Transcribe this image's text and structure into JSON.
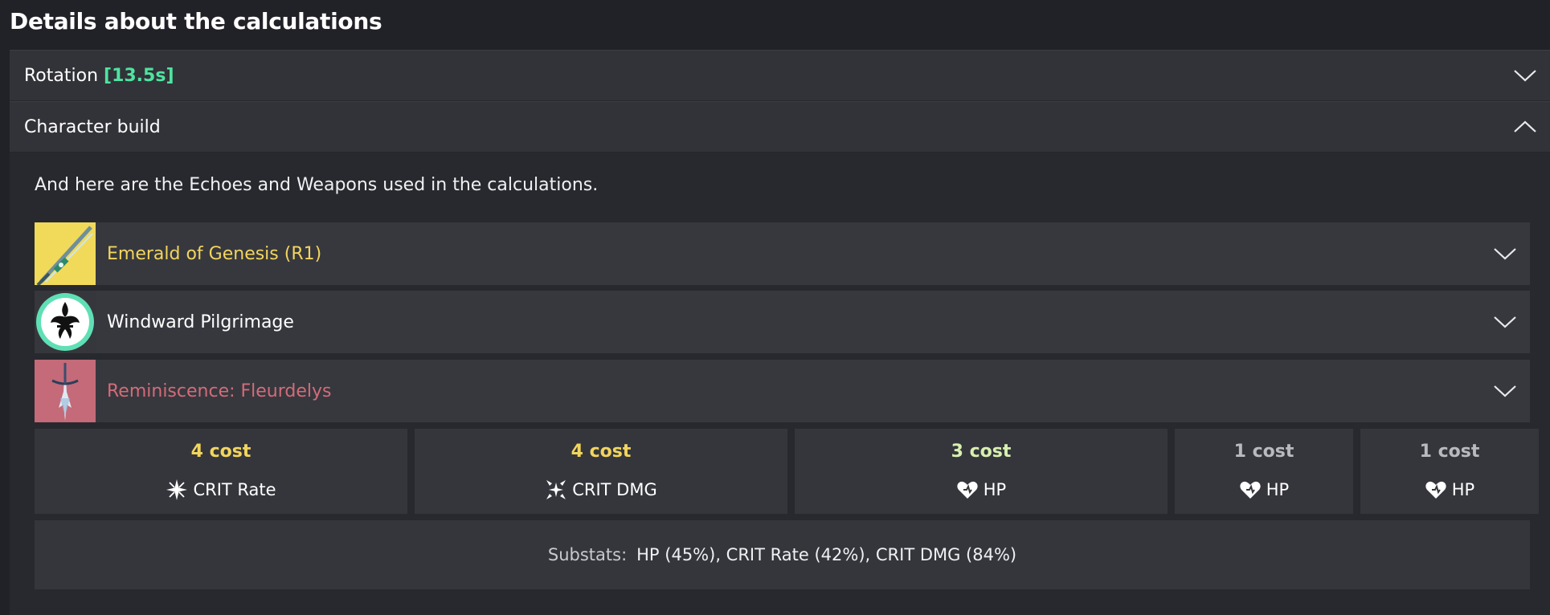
{
  "page_title": "Details about the calculations",
  "accordion": {
    "rotation": {
      "label": "Rotation",
      "duration": "[13.5s]",
      "expanded": false
    },
    "character_build": {
      "label": "Character build",
      "expanded": true
    }
  },
  "intro_text": "And here are the Echoes and Weapons used in the calculations.",
  "items": [
    {
      "name": "Emerald of Genesis (R1)",
      "color": "#f2d55e",
      "thumb_bg": "#f1d95a",
      "icon": "sword-weapon-icon"
    },
    {
      "name": "Windward Pilgrimage",
      "color": "#ffffff",
      "thumb_bg": "#36373d",
      "icon": "echo-set-emblem-icon"
    },
    {
      "name": "Reminiscence: Fleurdelys",
      "color": "#d36c79",
      "thumb_bg": "#c46a78",
      "icon": "echo-creature-icon"
    }
  ],
  "cost_cards": [
    {
      "cost": "4 cost",
      "cost_color": "#f2d55e",
      "stat": "CRIT Rate",
      "icon": "crit-rate-icon"
    },
    {
      "cost": "4 cost",
      "cost_color": "#f2d55e",
      "stat": "CRIT DMG",
      "icon": "crit-dmg-icon"
    },
    {
      "cost": "3 cost",
      "cost_color": "#d8f0b0",
      "stat": "HP",
      "icon": "hp-heart-icon"
    },
    {
      "cost": "1 cost",
      "cost_color": "#b9bac0",
      "stat": "HP",
      "icon": "hp-heart-icon"
    },
    {
      "cost": "1 cost",
      "cost_color": "#b9bac0",
      "stat": "HP",
      "icon": "hp-heart-icon"
    }
  ],
  "substats": {
    "label": "Substats:",
    "value": "HP (45%), CRIT Rate (42%), CRIT DMG (84%)"
  }
}
